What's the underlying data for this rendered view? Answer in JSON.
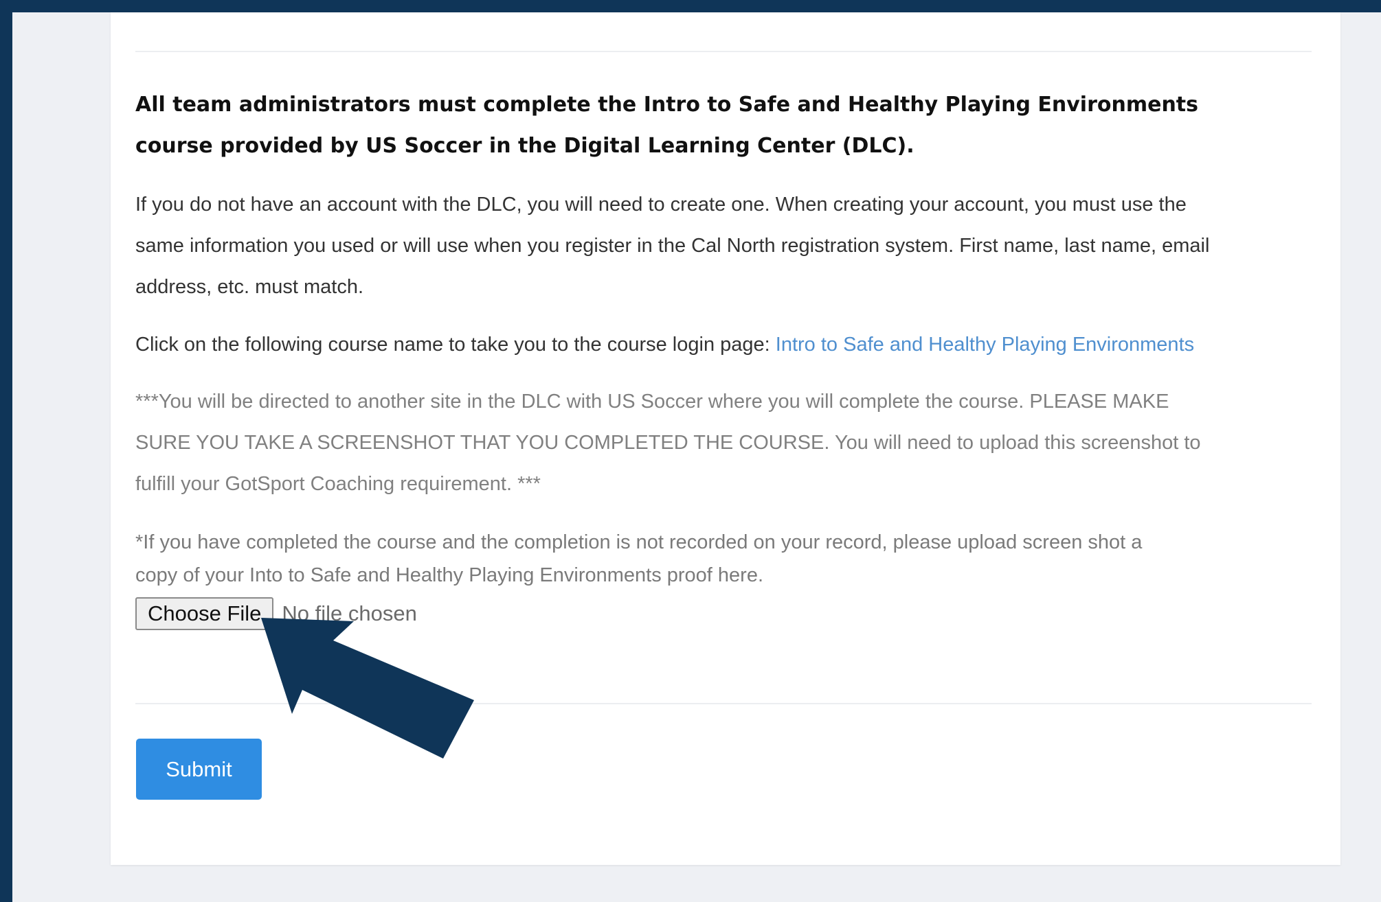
{
  "form": {
    "heading_line1": "All team administrators must complete the Intro to Safe and Healthy Playing Environments",
    "heading_line2": "course provided by US Soccer  in the Digital Learning Center (DLC).",
    "info_line1": "If you do not have an account with the DLC, you will need to create one. When creating your account, you must use the",
    "info_line2": "same information you used or will use when you register in the Cal North registration system. First name, last name, email",
    "info_line3": "address, etc. must match.",
    "click_text": "Click on the following course name to take you to the course login page: ",
    "course_link": "Intro to Safe and Healthy Playing Environments",
    "note_line1": "***You will be directed to another site in the DLC with US Soccer where you will complete the course. PLEASE MAKE",
    "note_line2": "SURE YOU TAKE A SCREENSHOT THAT YOU COMPLETED THE COURSE. You will need to upload this screenshot to",
    "note_line3": "fulfill your GotSport Coaching requirement. ***",
    "upload_line1": "*If you have completed the course and the completion is not recorded on your record, please upload screen shot a",
    "upload_line2": "copy of your Into to Safe and Healthy Playing Environments proof here.",
    "choose_file_label": "Choose File",
    "file_status": "No file chosen",
    "submit_label": "Submit"
  },
  "colors": {
    "frame": "#0f3558",
    "page_background": "#eef0f4",
    "card": "#ffffff",
    "link": "#4f8fcf",
    "submit": "#2f8de2",
    "arrow": "#0f3558"
  },
  "icons": {
    "annotation": "arrow-pointing-up-left"
  }
}
